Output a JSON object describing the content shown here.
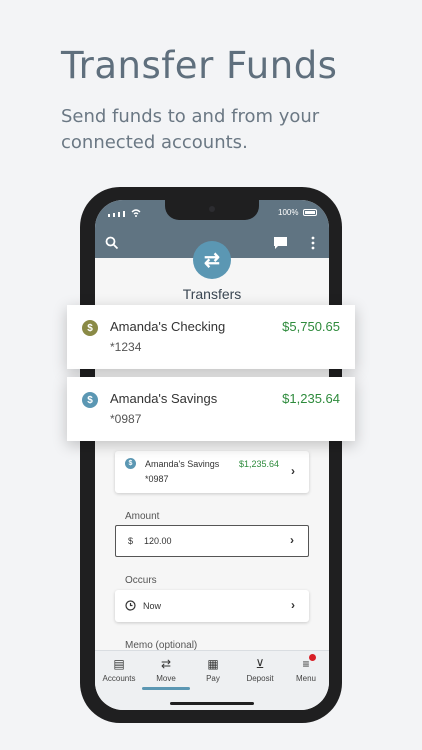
{
  "promo": {
    "title": "Transfer Funds",
    "subtitle": "Send funds to and from your connected accounts."
  },
  "status_bar": {
    "battery": "100%"
  },
  "screen": {
    "title": "Transfers",
    "to_account": {
      "name": "Amanda's Savings",
      "number": "*0987",
      "balance": "$1,235.64"
    },
    "amount": {
      "label": "Amount",
      "currency": "$",
      "value": "120.00"
    },
    "occurs": {
      "label": "Occurs",
      "value": "Now"
    },
    "memo": {
      "label": "Memo (optional)"
    }
  },
  "accounts_popup": [
    {
      "name": "Amanda's Checking",
      "number": "*1234",
      "balance": "$5,750.65",
      "icon_color": "#8a8a46"
    },
    {
      "name": "Amanda's Savings",
      "number": "*0987",
      "balance": "$1,235.64",
      "icon_color": "#5b97b3"
    }
  ],
  "nav": {
    "items": [
      {
        "label": "Accounts",
        "icon": "accounts-icon"
      },
      {
        "label": "Move",
        "icon": "move-icon"
      },
      {
        "label": "Pay",
        "icon": "pay-icon"
      },
      {
        "label": "Deposit",
        "icon": "deposit-icon"
      },
      {
        "label": "Menu",
        "icon": "menu-icon"
      }
    ],
    "active": "Move"
  },
  "colors": {
    "header": "#607482",
    "accent": "#5b97b3",
    "positive": "#2e8b3c",
    "notification": "#d81f26"
  }
}
